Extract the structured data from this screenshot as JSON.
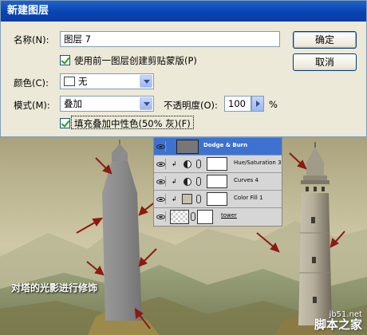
{
  "dialog": {
    "title": "新建图层",
    "name_label": "名称(N):",
    "name_value": "图层 7",
    "clip_checkbox_label": "使用前一图层创建剪贴蒙版(P)",
    "color_label": "颜色(C):",
    "color_value": "无",
    "mode_label": "模式(M):",
    "mode_value": "叠加",
    "opacity_label": "不透明度(O):",
    "opacity_value": "100",
    "opacity_unit": "%",
    "fill_checkbox_label": "填充叠加中性色(50% 灰)(F)",
    "ok_label": "确定",
    "cancel_label": "取消",
    "clip_checked": true,
    "fill_checked": true
  },
  "layers_panel": {
    "layers": [
      {
        "name": "Dodge & Burn",
        "selected": true
      },
      {
        "name": "Hue/Saturation 3"
      },
      {
        "name": "Curves 4"
      },
      {
        "name": "Color Fill 1"
      },
      {
        "name": "tower"
      }
    ]
  },
  "photo": {
    "caption": "对塔的光影进行修饰",
    "watermark_url": "jb51.net",
    "watermark_site": "脚本之家"
  },
  "colors": {
    "titlebar": "#0a46b8",
    "selected_layer": "#3d72d1",
    "arrow": "#8b1a12",
    "dialog_bg": "#ece9d8"
  }
}
